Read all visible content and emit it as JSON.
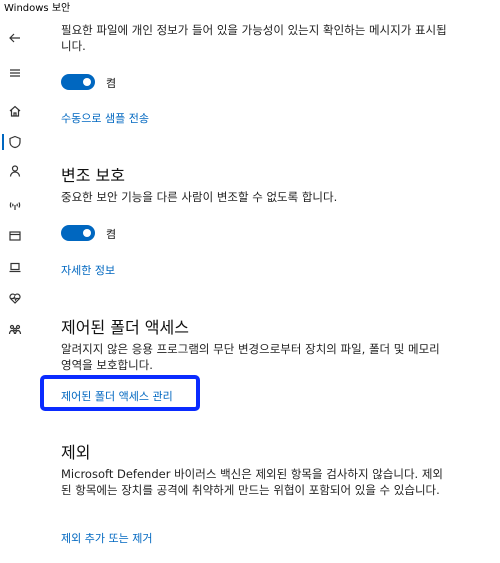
{
  "window": {
    "title": "Windows 보안"
  },
  "sidebar": {
    "items": [
      {
        "icon": "back-arrow-icon"
      },
      {
        "icon": "hamburger-icon"
      },
      {
        "icon": "home-icon"
      },
      {
        "icon": "shield-icon",
        "active": true
      },
      {
        "icon": "person-icon"
      },
      {
        "icon": "network-icon"
      },
      {
        "icon": "app-browser-icon"
      },
      {
        "icon": "laptop-icon"
      },
      {
        "icon": "heart-icon"
      },
      {
        "icon": "family-icon"
      }
    ]
  },
  "sections": {
    "sample": {
      "description": "필요한 파일에 개인 정보가 들어 있을 가능성이 있는지 확인하는 메시지가 표시됩니다.",
      "toggle_label": "켬",
      "link": "수동으로 샘플 전송"
    },
    "tamper": {
      "title": "변조 보호",
      "description": "중요한 보안 기능을 다른 사람이 변조할 수 없도록 합니다.",
      "toggle_label": "켬",
      "link": "자세한 정보"
    },
    "folder_access": {
      "title": "제어된 폴더 액세스",
      "description": "알려지지 않은 응용 프로그램의 무단 변경으로부터 장치의 파일, 폴더 및 메모리 영역을 보호합니다.",
      "link": "제어된 폴더 액세스 관리"
    },
    "exclusions": {
      "title": "제외",
      "description": "Microsoft Defender 바이러스 백신은 제외된 항목을 검사하지 않습니다. 제외된 항목에는 장치를 공격에 취약하게 만드는 위협이 포함되어 있을 수 있습니다.",
      "link": "제외 추가 또는 제거"
    }
  },
  "colors": {
    "accent": "#0067c0",
    "highlight": "#0a2bff"
  }
}
